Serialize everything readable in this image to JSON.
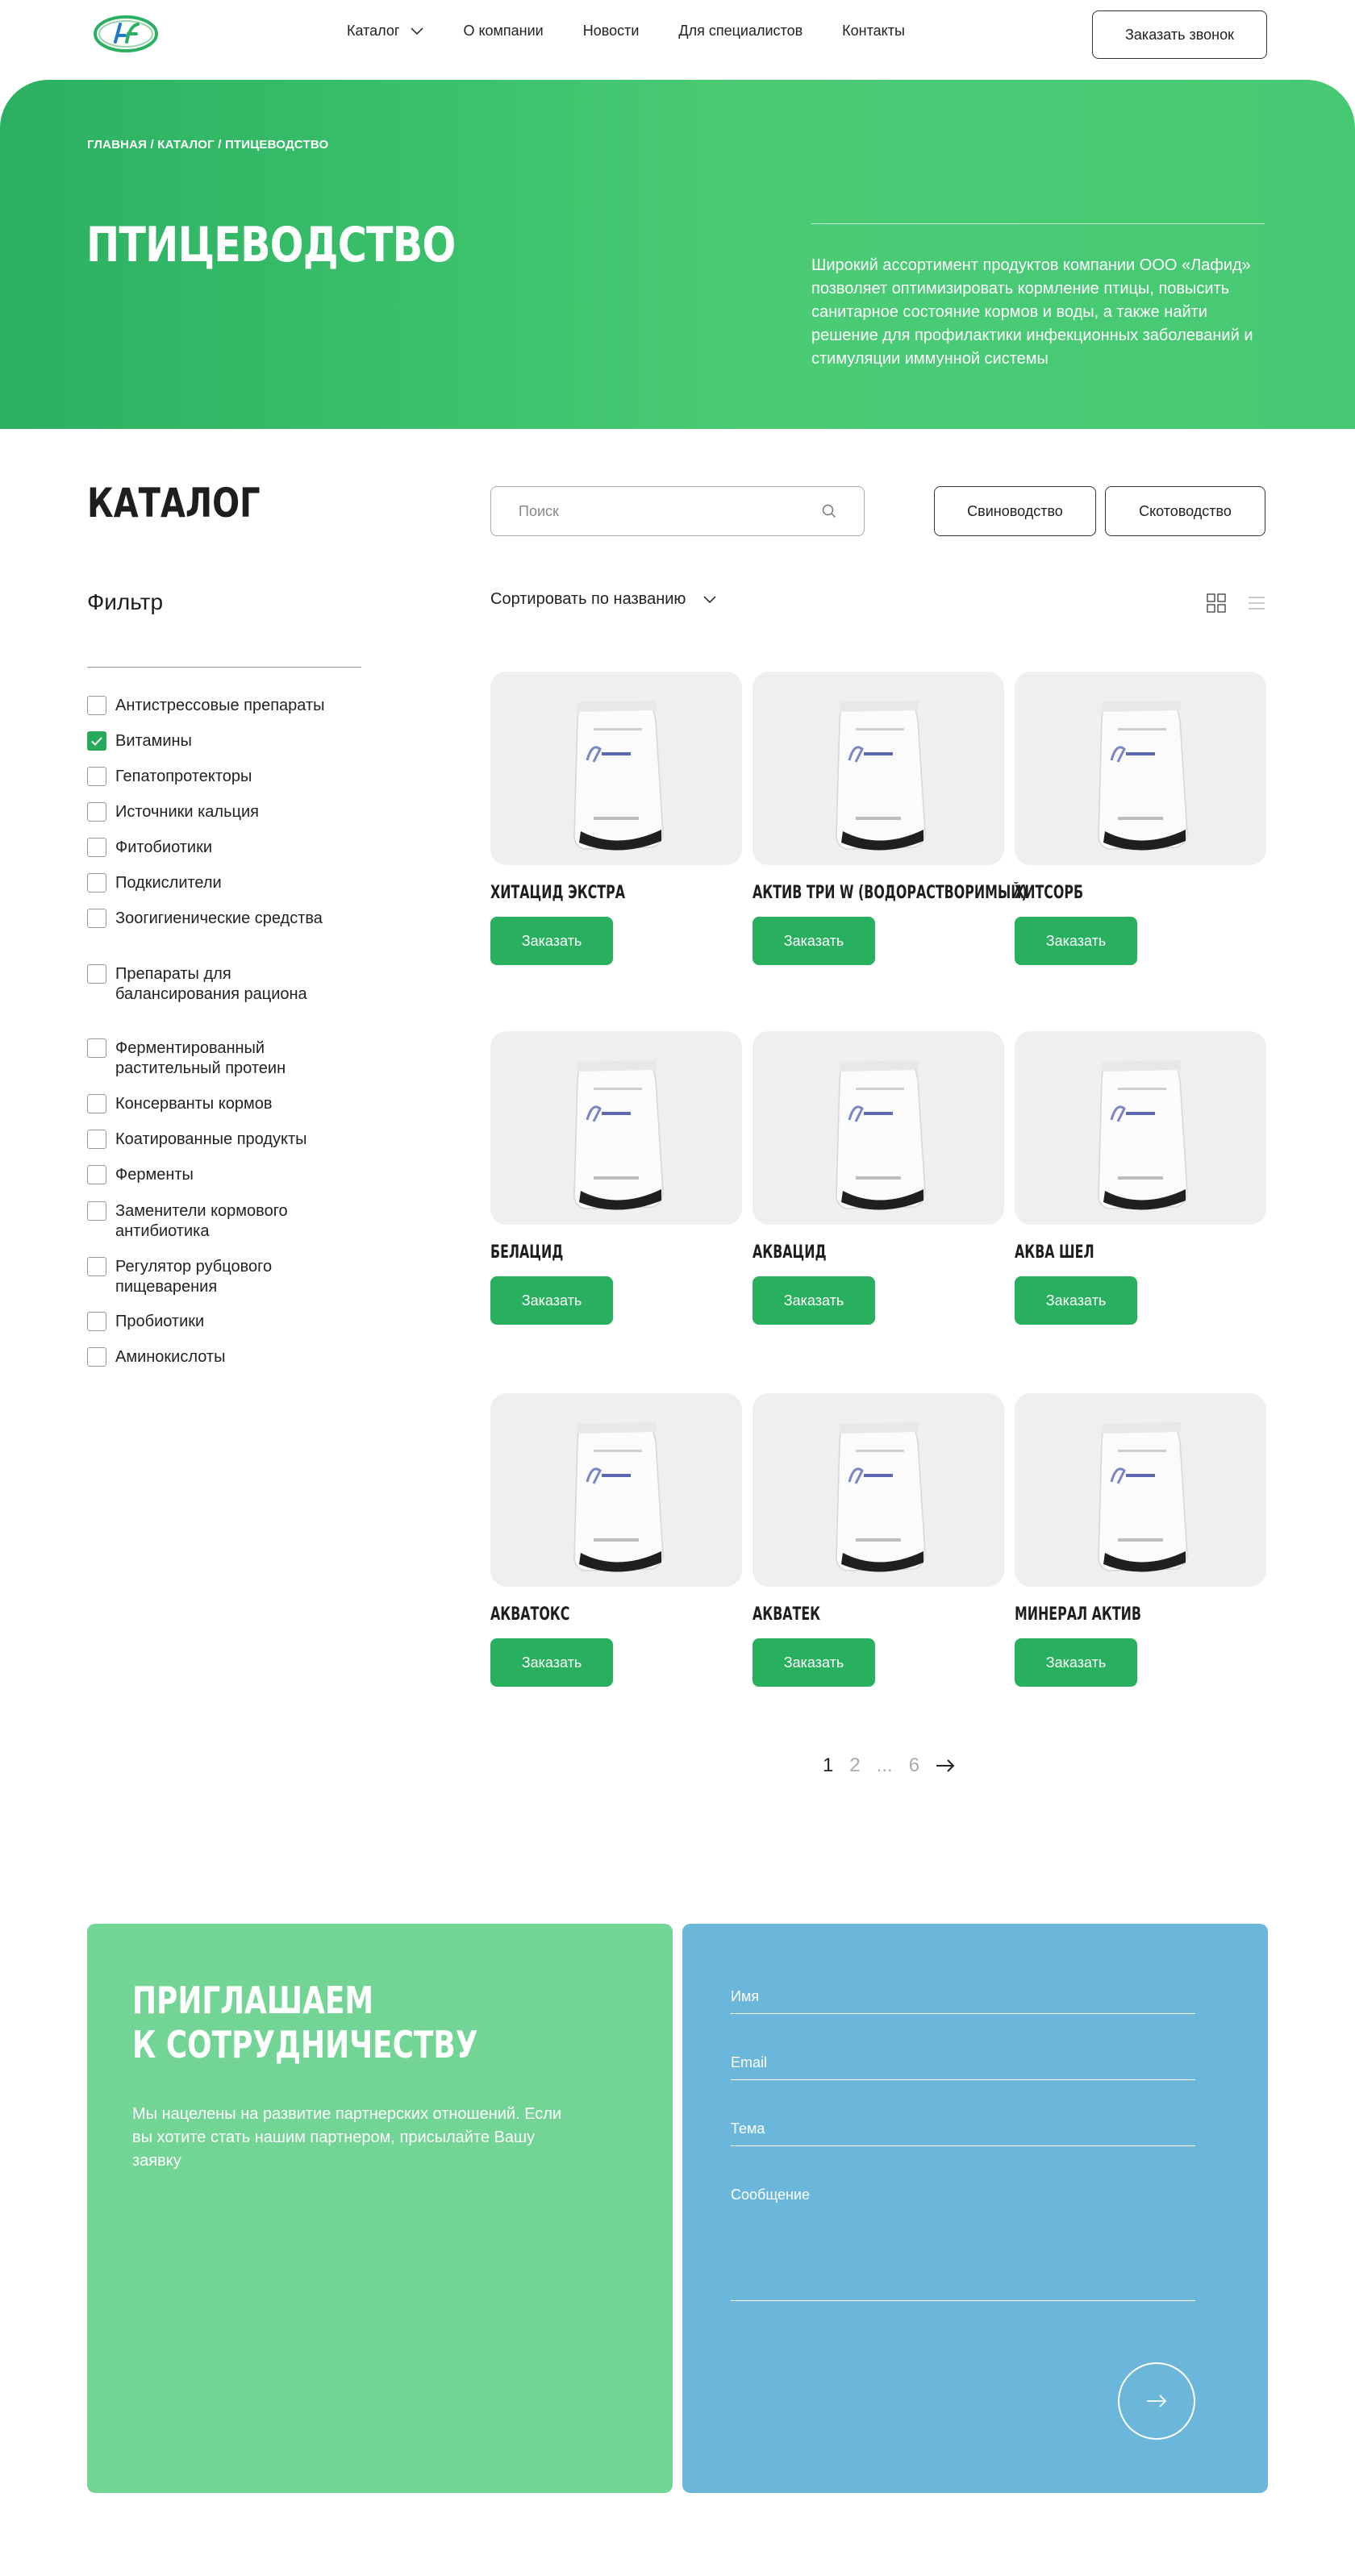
{
  "header": {
    "nav": [
      {
        "label": "Каталог",
        "has_dropdown": true
      },
      {
        "label": "О компании"
      },
      {
        "label": "Новости"
      },
      {
        "label": "Для специалистов"
      },
      {
        "label": "Контакты"
      }
    ],
    "call_button": "Заказать звонок"
  },
  "hero": {
    "breadcrumb": "ГЛАВНАЯ / КАТАЛОГ / ПТИЦЕВОДСТВО",
    "title": "ПТИЦЕВОДСТВО",
    "description": "Широкий ассортимент продуктов компании ООО «Лафид» позволяет оптимизировать кормление птицы, повысить санитарное состояние кормов и воды, а также найти решение для профилактики инфекционных заболеваний и стимуляции иммунной системы"
  },
  "catalog": {
    "title": "КАТАЛОГ",
    "search_placeholder": "Поиск",
    "category_buttons": [
      "Свиноводство",
      "Скотоводство"
    ],
    "sort_label": "Сортировать по названию",
    "filter_title": "Фильтр",
    "filters": [
      {
        "label": "Антистрессовые препараты",
        "checked": false
      },
      {
        "label": "Витамины",
        "checked": true
      },
      {
        "label": "Гепатопротекторы",
        "checked": false
      },
      {
        "label": "Источники кальция",
        "checked": false
      },
      {
        "label": "Фитобиотики",
        "checked": false
      },
      {
        "label": "Подкислители",
        "checked": false
      },
      {
        "label": "Зоогигиенические средства",
        "checked": false
      },
      {
        "label": "Препараты для балансирования рациона",
        "checked": false
      },
      {
        "label": "Ферментированный растительный протеин",
        "checked": false
      },
      {
        "label": "Консерванты кормов",
        "checked": false
      },
      {
        "label": "Коатированные продукты",
        "checked": false
      },
      {
        "label": "Ферменты",
        "checked": false
      },
      {
        "label": "Заменители кормового антибиотика",
        "checked": false
      },
      {
        "label": "Регулятор рубцового пищеварения",
        "checked": false
      },
      {
        "label": "Пробиотики",
        "checked": false
      },
      {
        "label": "Аминокислоты",
        "checked": false
      }
    ],
    "order_label": "Заказать",
    "products": [
      {
        "name": "ХИТАЦИД ЭКСТРА"
      },
      {
        "name": "АКТИВ ТРИ W (ВОДОРАСТВОРИМЫЙ)"
      },
      {
        "name": "ХИТСОРБ"
      },
      {
        "name": "БЕЛАЦИД"
      },
      {
        "name": "АКВАЦИД"
      },
      {
        "name": "АКВА ШЕЛ"
      },
      {
        "name": "АКВАТОКС"
      },
      {
        "name": "АКВАТЕК"
      },
      {
        "name": "МИНЕРАЛ АКТИВ"
      }
    ],
    "pagination": [
      "1",
      "2",
      "...",
      "6"
    ],
    "pagination_active": "1"
  },
  "cooperation": {
    "title_line1": "ПРИГЛАШАЕМ",
    "title_line2": "К СОТРУДНИЧЕСТВУ",
    "description": "Мы нацелены на развитие партнерских отношений. Если вы хотите стать нашим партнером, присылайте Вашу заявку",
    "form": {
      "name_placeholder": "Имя",
      "email_placeholder": "Email",
      "subject_placeholder": "Тема",
      "message_placeholder": "Сообщение"
    }
  },
  "colors": {
    "brand_green": "#28b05e",
    "hero_green": "#3cc26b",
    "coop_green": "#72d595",
    "coop_blue": "#6bb7dc"
  }
}
